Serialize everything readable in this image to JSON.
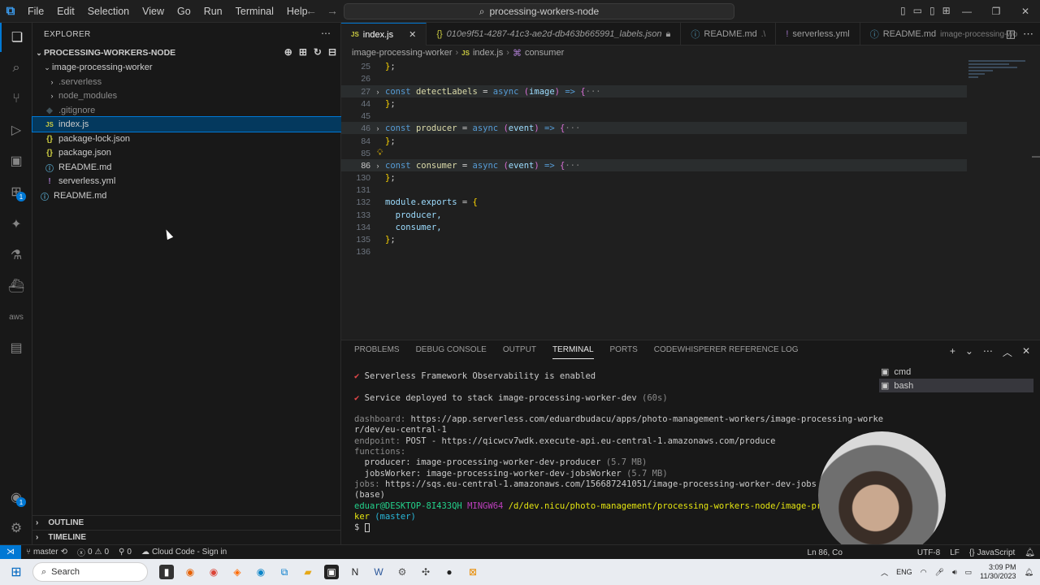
{
  "titlebar": {
    "menu": [
      "File",
      "Edit",
      "Selection",
      "View",
      "Go",
      "Run",
      "Terminal",
      "Help"
    ],
    "search_text": "processing-workers-node"
  },
  "explorer": {
    "header": "EXPLORER",
    "root": "PROCESSING-WORKERS-NODE",
    "folder": "image-processing-worker",
    "items": [
      ".serverless",
      "node_modules",
      ".gitignore",
      "index.js",
      "package-lock.json",
      "package.json",
      "README.md",
      "serverless.yml"
    ],
    "root_readme": "README.md",
    "outline": "OUTLINE",
    "timeline": "TIMELINE"
  },
  "tabs": [
    {
      "label": "index.js",
      "extra": ""
    },
    {
      "label": "010e9f51-4287-41c3-ae2d-db463b665991_labels.json",
      "extra": ""
    },
    {
      "label": "README.md",
      "extra": ".\\"
    },
    {
      "label": "serverless.yml",
      "extra": ""
    },
    {
      "label": "README.md",
      "extra": "image-processing-wo"
    }
  ],
  "breadcrumb": [
    "image-processing-worker",
    "index.js",
    "consumer"
  ],
  "code": {
    "line_numbers": [
      "25",
      "26",
      "27",
      "44",
      "45",
      "46",
      "84",
      "85",
      "86",
      "130",
      "131",
      "132",
      "133",
      "134",
      "135",
      "136"
    ],
    "detectLabels": {
      "kw": "const",
      "name": "detectLabels",
      "async": "async",
      "param": "image"
    },
    "producer": {
      "kw": "const",
      "name": "producer",
      "async": "async",
      "param": "event"
    },
    "consumer": {
      "kw": "const",
      "name": "consumer",
      "async": "async",
      "param": "event"
    },
    "module": "module",
    "exports": "exports",
    "export_items": [
      "producer,",
      "consumer,"
    ]
  },
  "panel": {
    "tabs": [
      "PROBLEMS",
      "DEBUG CONSOLE",
      "OUTPUT",
      "TERMINAL",
      "PORTS",
      "CODEWHISPERER REFERENCE LOG"
    ],
    "terminals": [
      "cmd",
      "bash"
    ]
  },
  "terminal": {
    "l1": "Serverless Framework Observability is enabled",
    "l2": "Service deployed to stack image-processing-worker-dev",
    "l2_time": "(60s)",
    "dashboard_label": "dashboard:",
    "dashboard_url": "https://app.serverless.com/eduardbudacu/apps/photo-management-workers/image-processing-worke",
    "dashboard_url2": "r/dev/eu-central-1",
    "endpoint_label": "endpoint:",
    "endpoint": "POST - https://qicwcv7wdk.execute-api.eu-central-1.amazonaws.com/produce",
    "functions_label": "functions:",
    "fn1": "producer: image-processing-worker-dev-producer",
    "fn1_size": "(5.7 MB)",
    "fn2": "jobsWorker: image-processing-worker-dev-jobsWorker",
    "fn2_size": "(5.7 MB)",
    "jobs_label": "jobs:",
    "jobs_url": "https://sqs.eu-central-1.amazonaws.com/156687241051/image-processing-worker-dev-jobs",
    "base": "(base)",
    "user": "eduar@DESKTOP-8I433QH",
    "mingw": "MINGW64",
    "path": "/d/dev.nicu/photo-management/processing-workers-node/image-proces",
    "path2": "ker",
    "branch": "(master)",
    "prompt": "$"
  },
  "statusbar": {
    "branch": "master",
    "errors": "0",
    "warnings": "0",
    "ports": "0",
    "cloud": "Cloud Code - Sign in",
    "position": "Ln 86, Co",
    "encoding": "UTF-8",
    "eol": "LF",
    "language": "JavaScript"
  },
  "taskbar": {
    "search": "Search",
    "lang": "ENG",
    "time": "3:09 PM",
    "date": "11/30/2023"
  }
}
